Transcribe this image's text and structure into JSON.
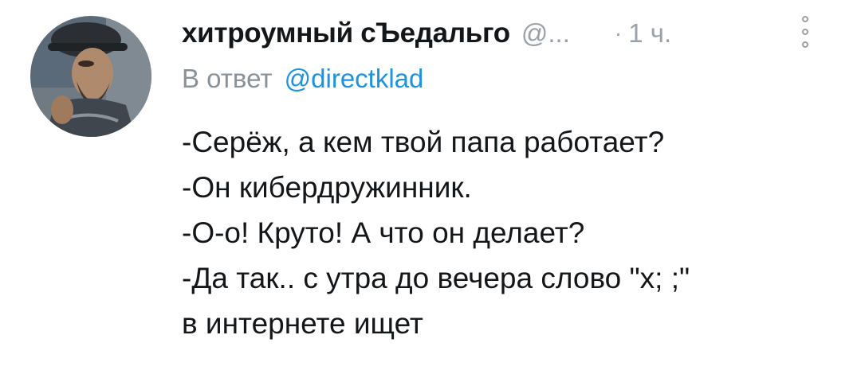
{
  "tweet": {
    "display_name": "хитроумный сЪедальго",
    "handle": "@...",
    "separator": "·",
    "timestamp": "1 ч.",
    "more_icon": "vertical-dots-icon",
    "reply_prefix": "В ответ",
    "reply_mention": "@directklad",
    "text_lines": [
      "-Серёж, а кем твой папа работает?",
      "-Он кибердружинник.",
      "-О-о! Круто! А что он делает?",
      "-Да так.. с утра до вечера слово \"х; ;\"",
      "в интернете ищет"
    ]
  },
  "colors": {
    "name": "#14171a",
    "secondary": "#9aa1a8",
    "link": "#1c94e0",
    "body": "#14171a"
  }
}
